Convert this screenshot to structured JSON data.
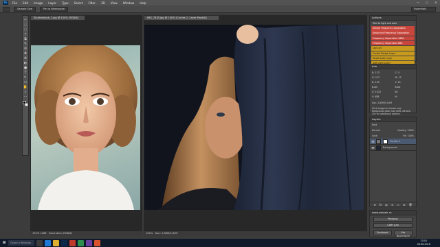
{
  "app": {
    "logo": "Ps"
  },
  "menu": [
    "File",
    "Edit",
    "Image",
    "Layer",
    "Type",
    "Select",
    "Filter",
    "3D",
    "View",
    "Window",
    "Help"
  ],
  "window_controls": [
    "—",
    "☐",
    "✕"
  ],
  "options": {
    "btn1": "Sample Size",
    "btn2": "Pin to Workspace",
    "workspace": "Essentials"
  },
  "tools": [
    "⊹",
    "⬚",
    "◌",
    "⌖",
    "⧉",
    "✎",
    "⊘",
    "✚",
    "⊕",
    "◐",
    "●",
    "T",
    "↖",
    "▭",
    "✋",
    "⌕",
    "⋯"
  ],
  "doc_left": {
    "tab": "Shutterstock_1.jpg @ 100% (RGB/8)",
    "zoom": "192% 1286",
    "status": "Saturation (RGB/8)"
  },
  "doc_right": {
    "tab": "IMG_7835.jpg @ 100% (Curves 1, Layer Mask/8)",
    "zoom": "100%",
    "status": "Doc: 2,80M/5,62M"
  },
  "actions": {
    "title": "Actions",
    "items": [
      {
        "label": "Skin to light and dark",
        "tone": "white"
      },
      {
        "label": "Simple Frequency Separation",
        "tone": "red"
      },
      {
        "label": "Advanced Frequency Separation",
        "tone": "red"
      },
      {
        "label": "Frequency Separation 16Bit",
        "tone": "red"
      },
      {
        "label": "Frequency Separation 8Bit",
        "tone": "red"
      },
      {
        "label": "Lock All",
        "tone": "gold"
      },
      {
        "label": "Create Dodge Layer",
        "tone": "gold"
      },
      {
        "label": "Desaturate Layer",
        "tone": "gold"
      },
      {
        "label": "Soft Light Layer",
        "tone": "gold"
      }
    ]
  },
  "info": {
    "title": "Info",
    "rows": [
      {
        "a": "R: 123",
        "b": "C: 5"
      },
      {
        "a": "G: 112",
        "b": "M: 12"
      },
      {
        "a": "B: 109",
        "b": "Y: 15"
      },
      {
        "a": "8-bit",
        "b": "8-bit"
      },
      {
        "a": "X: 1022",
        "b": "W:"
      },
      {
        "a": "Y: 458",
        "b": "H:"
      }
    ],
    "doc": "Doc: 2,80M/5,62M",
    "note": "Click image to choose new foreground color. Use Shift, Alt and Ctrl for additional options."
  },
  "layers": {
    "title": "Layers",
    "kind": "Kind",
    "mode": "Normal",
    "opacity": "Opacity: 100%",
    "lock": "Lock:",
    "fill": "Fill: 100%",
    "rows": [
      {
        "name": "Curves 1",
        "selected": true
      },
      {
        "name": "Background",
        "selected": false
      }
    ],
    "bottom_icons": [
      "⊕",
      "fx",
      "◐",
      "⊘",
      "▭",
      "⊞",
      "🗑"
    ]
  },
  "site": {
    "title": "www.ssbook.ru",
    "btn1": "Ресурсы",
    "btn2": "Сайт для",
    "btn3": "Facebook",
    "btn4": "Мы Вконтакте"
  },
  "taskbar": {
    "search": "Поиск в Windows",
    "time": "13:01",
    "date": "06.06.2016"
  }
}
